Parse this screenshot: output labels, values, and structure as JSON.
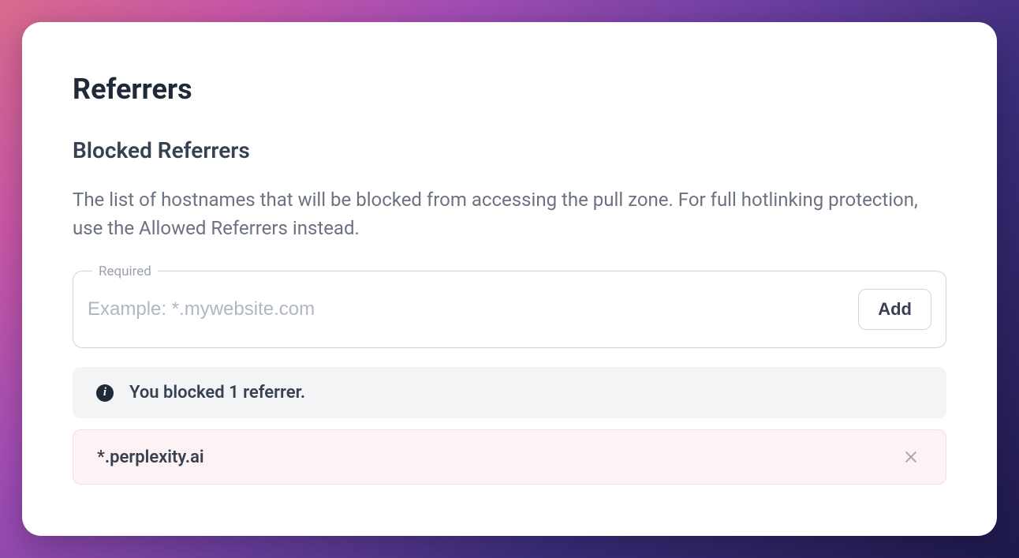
{
  "page": {
    "title": "Referrers"
  },
  "blocked": {
    "section_title": "Blocked Referrers",
    "description": "The list of hostnames that will be blocked from accessing the pull zone. For full hotlinking protection, use the Allowed Referrers instead.",
    "input_legend": "Required",
    "input_placeholder": "Example: *.mywebsite.com",
    "add_label": "Add",
    "status_text": "You blocked 1 referrer.",
    "items": [
      {
        "hostname": "*.perplexity.ai"
      }
    ]
  }
}
